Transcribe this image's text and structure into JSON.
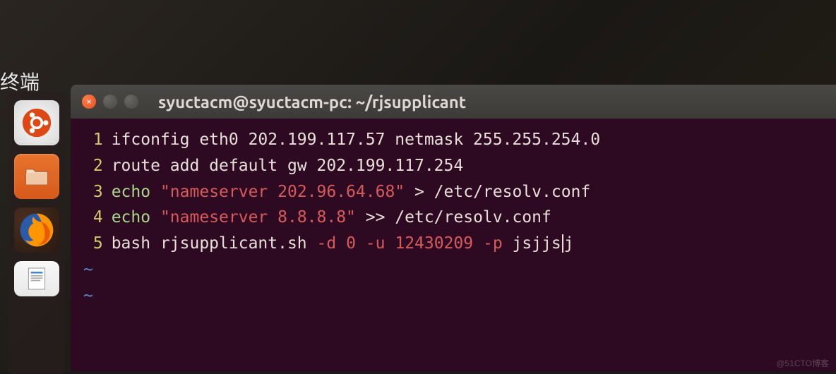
{
  "desktop": {
    "top_label": "终端"
  },
  "launcher": {
    "items": [
      {
        "name": "ubuntu-dash",
        "icon": "ubuntu-logo"
      },
      {
        "name": "files",
        "icon": "folder"
      },
      {
        "name": "firefox",
        "icon": "firefox"
      },
      {
        "name": "document",
        "icon": "doc"
      }
    ]
  },
  "window": {
    "title": "syuctacm@syuctacm-pc: ~/rjsupplicant",
    "close_char": "×"
  },
  "editor": {
    "lines": [
      {
        "num": "1",
        "segments": [
          {
            "t": "ifconfig eth0 202.199.117.57 netmask 255.255.254.0",
            "c": "plain"
          }
        ]
      },
      {
        "num": "2",
        "segments": [
          {
            "t": "route add default gw 202.199.117.254",
            "c": "plain"
          }
        ]
      },
      {
        "num": "3",
        "segments": [
          {
            "t": "echo ",
            "c": "keyword"
          },
          {
            "t": "\"nameserver 202.96.64.68\"",
            "c": "string"
          },
          {
            "t": " > /etc/resolv.conf",
            "c": "path"
          }
        ]
      },
      {
        "num": "4",
        "segments": [
          {
            "t": "echo ",
            "c": "keyword"
          },
          {
            "t": "\"nameserver 8.8.8.8\"",
            "c": "string"
          },
          {
            "t": " >> /etc/resolv.conf",
            "c": "path"
          }
        ]
      },
      {
        "num": "5",
        "segments": [
          {
            "t": "bash rjsupplicant.sh ",
            "c": "plain"
          },
          {
            "t": "-d",
            "c": "flag"
          },
          {
            "t": " ",
            "c": "plain"
          },
          {
            "t": "0",
            "c": "string"
          },
          {
            "t": " ",
            "c": "plain"
          },
          {
            "t": "-u",
            "c": "flag"
          },
          {
            "t": " ",
            "c": "plain"
          },
          {
            "t": "12430209",
            "c": "string"
          },
          {
            "t": " ",
            "c": "plain"
          },
          {
            "t": "-p",
            "c": "flag"
          },
          {
            "t": " jsjjs",
            "c": "plain"
          },
          {
            "cursor": true
          },
          {
            "t": "j",
            "c": "plain"
          }
        ]
      }
    ],
    "empty_lines": [
      "~",
      "~"
    ]
  },
  "watermark": "@51CTO博客"
}
